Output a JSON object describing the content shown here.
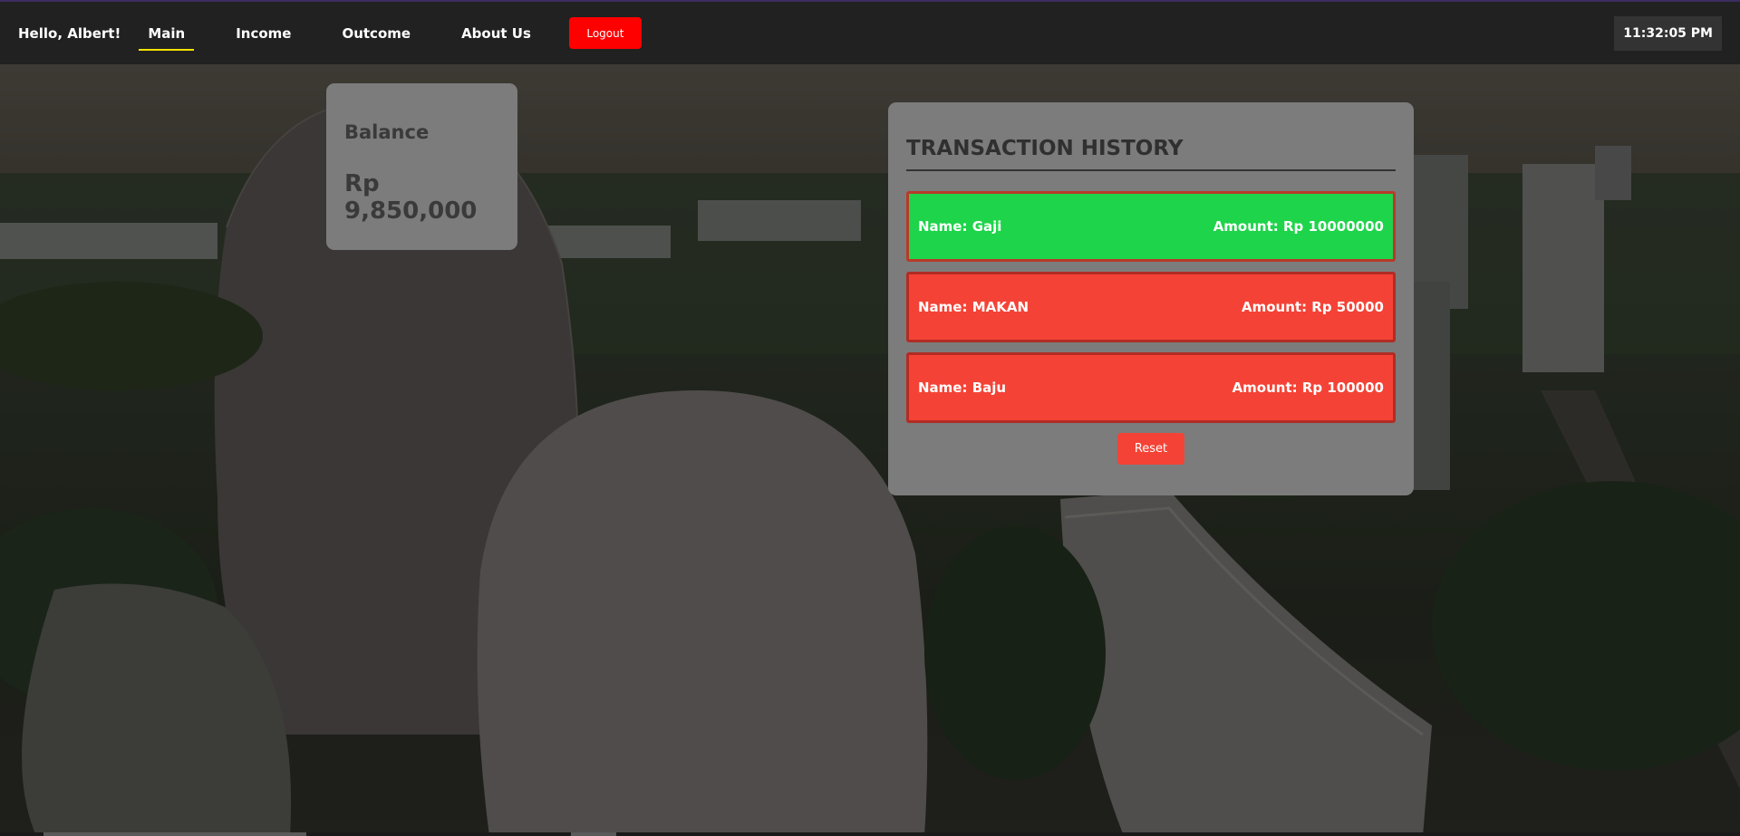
{
  "nav": {
    "greeting": "Hello, Albert!",
    "links": [
      {
        "label": "Main",
        "active": true
      },
      {
        "label": "Income",
        "active": false
      },
      {
        "label": "Outcome",
        "active": false
      },
      {
        "label": "About Us",
        "active": false
      }
    ],
    "logout_label": "Logout",
    "clock": "11:32:05 PM"
  },
  "balance": {
    "title": "Balance",
    "value": "Rp 9,850,000"
  },
  "history": {
    "title": "TRANSACTION HISTORY",
    "transactions": [
      {
        "name": "Name: Gaji",
        "amount": "Amount: Rp 10000000",
        "type": "income"
      },
      {
        "name": "Name: MAKAN",
        "amount": "Amount: Rp 50000",
        "type": "outcome"
      },
      {
        "name": "Name: Baju",
        "amount": "Amount: Rp 100000",
        "type": "outcome"
      }
    ],
    "reset_label": "Reset"
  },
  "colors": {
    "income": "#1ed44a",
    "outcome": "#f44336",
    "logout": "#ff0000",
    "nav_active_underline": "#f5e400"
  }
}
